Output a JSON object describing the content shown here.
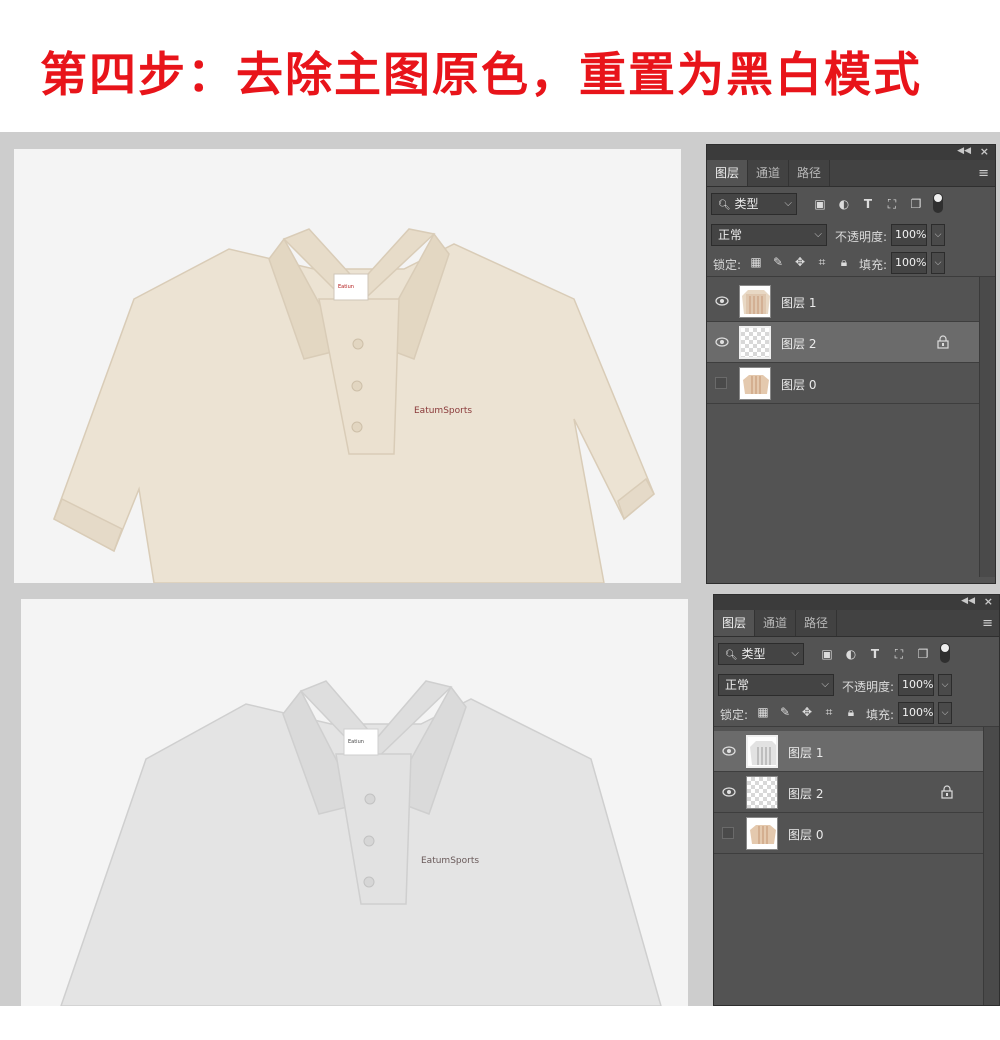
{
  "heading": "第四步：去除主图原色，重置为黑白模式",
  "colors": {
    "heading": "#e8141a",
    "shirt_original": "#ece3d3",
    "shirt_bw": "#e4e4e4",
    "panel_bg": "#535353"
  },
  "shirt": {
    "tag_text": "Eatiun",
    "logo_text": "EatumSports"
  },
  "panels": [
    {
      "tabs": [
        {
          "label": "图层",
          "active": true
        },
        {
          "label": "通道",
          "active": false
        },
        {
          "label": "路径",
          "active": false
        }
      ],
      "filter_kind": "类型",
      "blend_mode": "正常",
      "opacity_label": "不透明度:",
      "opacity_value": "100%",
      "lock_label": "锁定:",
      "fill_label": "填充:",
      "fill_value": "100%",
      "layers": [
        {
          "name": "图层 1",
          "visible": true,
          "selected": false,
          "locked": false,
          "thumb": "shirt-original",
          "framed": false
        },
        {
          "name": "图层 2",
          "visible": true,
          "selected": true,
          "locked": true,
          "thumb": "transparent",
          "framed": true
        },
        {
          "name": "图层 0",
          "visible": false,
          "selected": false,
          "locked": false,
          "thumb": "shirt-original-small",
          "framed": false
        }
      ]
    },
    {
      "tabs": [
        {
          "label": "图层",
          "active": true
        },
        {
          "label": "通道",
          "active": false
        },
        {
          "label": "路径",
          "active": false
        }
      ],
      "filter_kind": "类型",
      "blend_mode": "正常",
      "opacity_label": "不透明度:",
      "opacity_value": "100%",
      "lock_label": "锁定:",
      "fill_label": "填充:",
      "fill_value": "100%",
      "layers": [
        {
          "name": "图层 1",
          "visible": true,
          "selected": true,
          "locked": false,
          "thumb": "shirt-bw",
          "framed": true
        },
        {
          "name": "图层 2",
          "visible": true,
          "selected": false,
          "locked": true,
          "thumb": "transparent",
          "framed": false
        },
        {
          "name": "图层 0",
          "visible": false,
          "selected": false,
          "locked": false,
          "thumb": "shirt-original-small",
          "framed": false
        }
      ]
    }
  ]
}
